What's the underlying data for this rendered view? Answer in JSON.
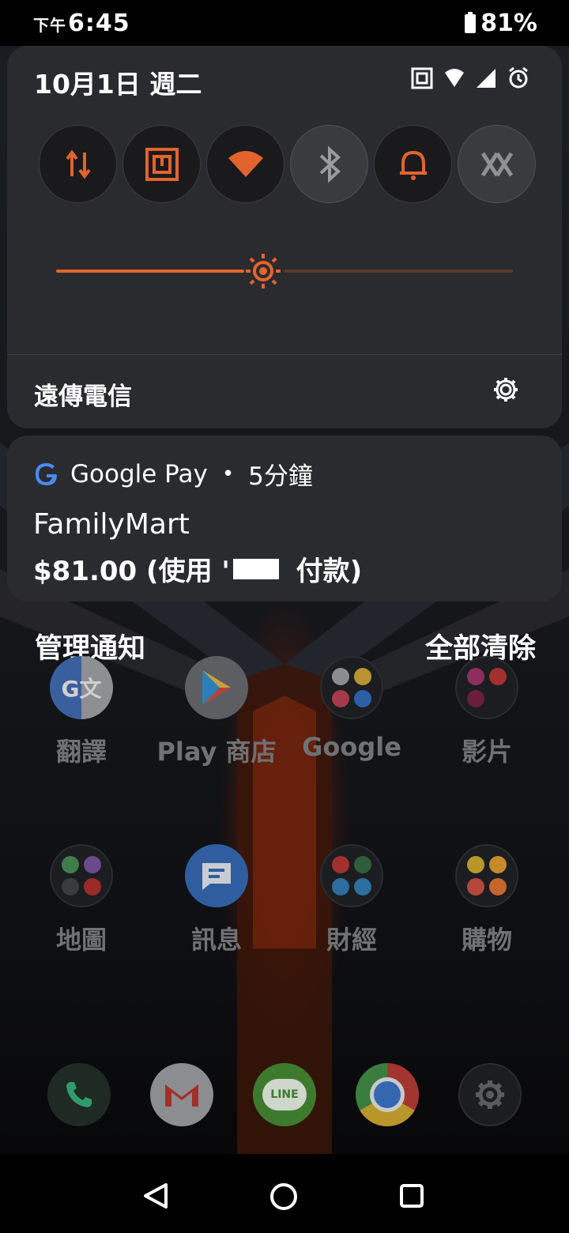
{
  "status_bar": {
    "time_prefix": "下午",
    "time": "6:45",
    "battery": "81%",
    "icons": [
      "battery-icon"
    ]
  },
  "quick_settings": {
    "date": "10月1日 週二",
    "status_icons": [
      "nfc-icon",
      "wifi-icon",
      "signal-icon",
      "alarm-icon"
    ],
    "tiles": [
      {
        "name": "mobile-data-icon",
        "on": true
      },
      {
        "name": "nfc-icon",
        "on": true
      },
      {
        "name": "wifi-icon",
        "on": true
      },
      {
        "name": "bluetooth-icon",
        "on": false
      },
      {
        "name": "sound-bell-icon",
        "on": true
      },
      {
        "name": "x-mode-icon",
        "on": false
      }
    ],
    "brightness_level": 0.41,
    "carrier": "遠傳電信",
    "accent_color": "#e3632d"
  },
  "notification": {
    "app": "Google Pay",
    "separator": "•",
    "time_ago": "5分鐘",
    "title": "FamilyMart",
    "body_before": "$81.00 (使用 '",
    "body_after": " 付款)"
  },
  "notification_actions": {
    "manage": "管理通知",
    "clear_all": "全部清除"
  },
  "home_apps": [
    {
      "label": "翻譯"
    },
    {
      "label": "Play 商店"
    },
    {
      "label": "Google"
    },
    {
      "label": "影片"
    },
    {
      "label": "地圖"
    },
    {
      "label": "訊息"
    },
    {
      "label": "財經"
    },
    {
      "label": "購物"
    }
  ],
  "dock": [
    "phone-icon",
    "gmail-icon",
    "line-icon",
    "chrome-icon",
    "settings-icon"
  ],
  "nav": [
    "back-icon",
    "home-icon",
    "recents-icon"
  ]
}
